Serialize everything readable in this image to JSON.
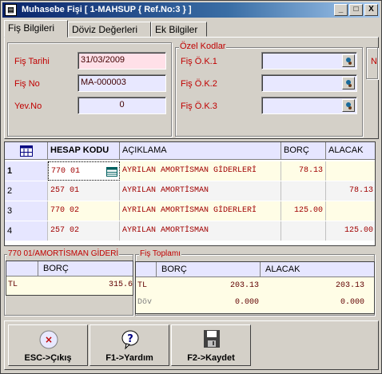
{
  "window": {
    "title": "Muhasebe Fişi [ 1-MAHSUP { Ref.No:3 } ]",
    "buttons": {
      "minimize": "_",
      "maximize": "□",
      "close": "X"
    }
  },
  "tabs": [
    "Fiş Bilgileri",
    "Döviz Değerleri",
    "Ek Bilgiler"
  ],
  "header": {
    "fis_tarihi_label": "Fiş Tarihi",
    "fis_tarihi_value": "31/03/2009",
    "fis_no_label": "Fiş No",
    "fis_no_value": "MA-000003",
    "yev_no_label": "Yev.No",
    "yev_no_value": "0"
  },
  "ozel_kodlar": {
    "group_title": "Özel Kodlar",
    "labels": [
      "Fiş Ö.K.1",
      "Fiş Ö.K.2",
      "Fiş Ö.K.3"
    ],
    "values": [
      "",
      "",
      ""
    ],
    "extra_label": "N"
  },
  "grid": {
    "columns": [
      "HESAP KODU",
      "AÇIKLAMA",
      "BORÇ",
      "ALACAK"
    ],
    "rows": [
      {
        "no": "1",
        "hesap": "770 01",
        "aciklama": "AYRILAN AMORTİSMAN GİDERLERİ",
        "borc": "78.13",
        "alacak": ""
      },
      {
        "no": "2",
        "hesap": "257 01",
        "aciklama": "AYRILAN AMORTİSMAN",
        "borc": "",
        "alacak": "78.13"
      },
      {
        "no": "3",
        "hesap": "770 02",
        "aciklama": "AYRILAN AMORTİSMAN GİDERLERİ",
        "borc": "125.00",
        "alacak": ""
      },
      {
        "no": "4",
        "hesap": "257 02",
        "aciklama": "AYRILAN AMORTİSMAN",
        "borc": "",
        "alacak": "125.00"
      }
    ]
  },
  "account_panel": {
    "title": "770 01/AMORTİSMAN GİDERİ",
    "col_borc": "BORÇ",
    "row_label": "TL",
    "row_value": "315.6"
  },
  "fis_toplami": {
    "title": "Fiş Toplamı",
    "col_borc": "BORÇ",
    "col_alacak": "ALACAK",
    "rows": [
      {
        "label": "TL",
        "borc": "203.13",
        "alacak": "203.13"
      },
      {
        "label": "Döv",
        "borc": "0.000",
        "alacak": "0.000"
      }
    ]
  },
  "buttons": {
    "esc": "ESC->Çıkış",
    "help": "F1->Yardım",
    "save": "F2->Kaydet"
  },
  "icons": [
    "app-icon",
    "cancel-icon",
    "help-icon",
    "save-icon",
    "lookup-icon",
    "grid-menu-icon"
  ]
}
